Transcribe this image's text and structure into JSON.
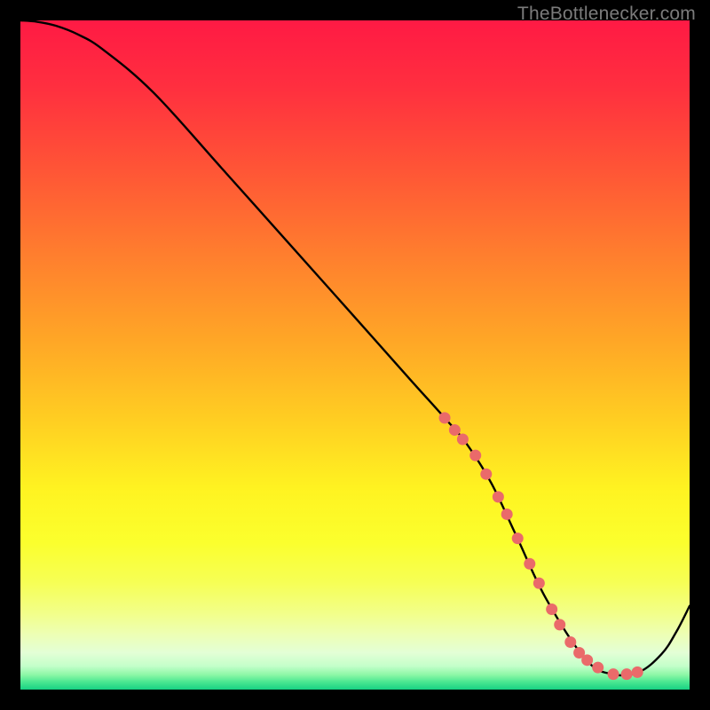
{
  "watermark": "TheBottlenecker.com",
  "gradient_stops": [
    {
      "offset": 0.0,
      "color": "#ff1a44"
    },
    {
      "offset": 0.1,
      "color": "#ff2f3f"
    },
    {
      "offset": 0.22,
      "color": "#ff5436"
    },
    {
      "offset": 0.35,
      "color": "#ff7e2e"
    },
    {
      "offset": 0.48,
      "color": "#ffa726"
    },
    {
      "offset": 0.6,
      "color": "#ffcf22"
    },
    {
      "offset": 0.7,
      "color": "#fff321"
    },
    {
      "offset": 0.78,
      "color": "#fbff2d"
    },
    {
      "offset": 0.84,
      "color": "#f6ff55"
    },
    {
      "offset": 0.885,
      "color": "#f2ff88"
    },
    {
      "offset": 0.918,
      "color": "#edffb5"
    },
    {
      "offset": 0.945,
      "color": "#e3ffd6"
    },
    {
      "offset": 0.965,
      "color": "#c3ffc9"
    },
    {
      "offset": 0.978,
      "color": "#8cf7a6"
    },
    {
      "offset": 0.988,
      "color": "#4de892"
    },
    {
      "offset": 1.0,
      "color": "#17d183"
    }
  ],
  "chart_data": {
    "type": "line",
    "title": "",
    "xlabel": "",
    "ylabel": "",
    "xlim": [
      0,
      100
    ],
    "ylim": [
      0,
      100
    ],
    "grid": false,
    "series": [
      {
        "name": "curve",
        "x": [
          0.0,
          2.5,
          5.3,
          8.6,
          12.4,
          19.9,
          30.0,
          40.1,
          50.1,
          58.1,
          63.4,
          66.7,
          70.4,
          74.1,
          78.6,
          84.5,
          88.5,
          92.4,
          95.8,
          98.0,
          100.0
        ],
        "y": [
          100.0,
          99.8,
          99.2,
          97.9,
          95.6,
          89.2,
          78.0,
          66.7,
          55.5,
          46.5,
          40.6,
          36.7,
          30.8,
          23.0,
          13.5,
          4.5,
          2.3,
          2.6,
          5.3,
          8.6,
          12.5
        ]
      }
    ],
    "marker_points_x": [
      63.4,
      64.9,
      66.1,
      68.0,
      69.6,
      71.4,
      72.7,
      74.3,
      76.1,
      77.5,
      79.4,
      80.6,
      82.2,
      83.5,
      84.7,
      86.3,
      88.6,
      90.6,
      92.2
    ],
    "marker_points_y": [
      40.6,
      38.8,
      37.4,
      35.0,
      32.2,
      28.8,
      26.2,
      22.6,
      18.8,
      15.9,
      12.0,
      9.7,
      7.1,
      5.5,
      4.4,
      3.3,
      2.3,
      2.3,
      2.6
    ],
    "marker_color": "#ea6a6a",
    "curve_color": "#000000"
  }
}
